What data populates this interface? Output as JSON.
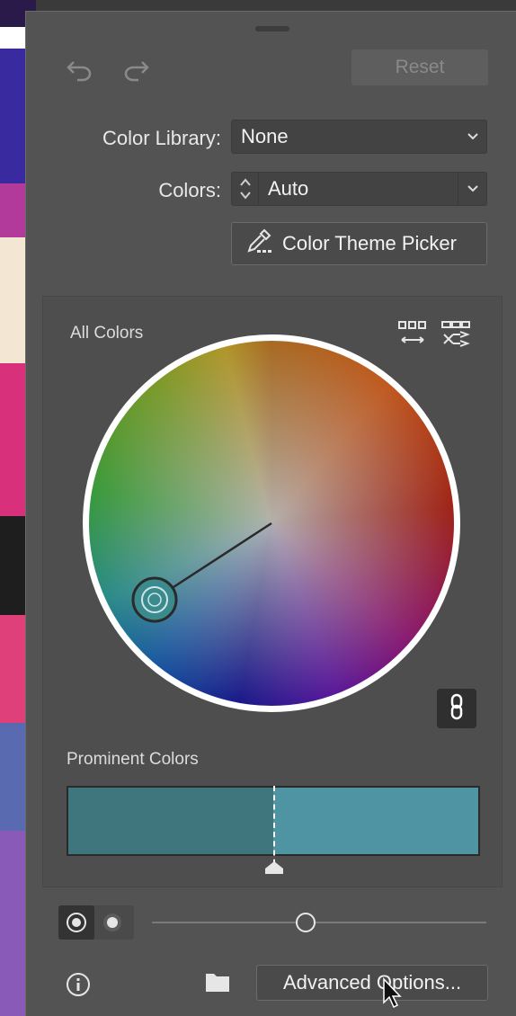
{
  "toolbar": {
    "undo_icon": "undo-icon",
    "redo_icon": "redo-icon",
    "reset_label": "Reset"
  },
  "color_library": {
    "label": "Color Library:",
    "value": "None"
  },
  "colors": {
    "label": "Colors:",
    "value": "Auto"
  },
  "theme_picker": {
    "label": "Color Theme Picker",
    "icon": "eyedropper-icon"
  },
  "wheel_section": {
    "title": "All Colors",
    "selected_color": "#3f8a8e",
    "link_icon": "link-icon"
  },
  "prominent": {
    "title": "Prominent Colors",
    "swatches": [
      {
        "color": "#3f757d",
        "share": 0.5
      },
      {
        "color": "#4f94a2",
        "share": 0.5
      }
    ]
  },
  "bottom": {
    "slider_value": 0.46,
    "advanced_label": "Advanced Options..."
  },
  "colors_theme": {
    "panel": "#535353",
    "accent_white": "#ffffff"
  }
}
